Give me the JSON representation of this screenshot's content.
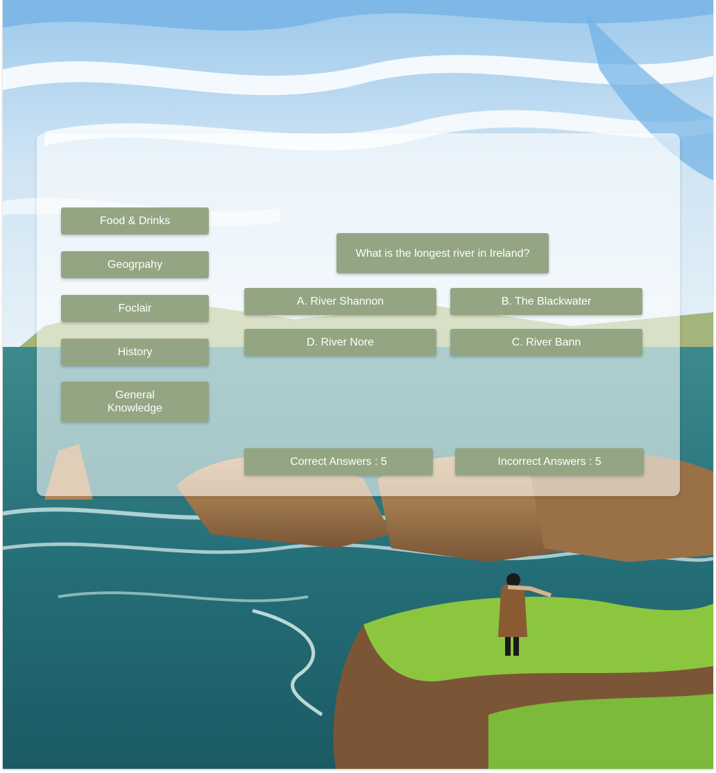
{
  "colors": {
    "button": "#94a583",
    "button_text": "#ffffff",
    "panel": "rgba(255,255,255,0.58)"
  },
  "categories": [
    {
      "label": "Food & Drinks"
    },
    {
      "label": "Geogrpahy"
    },
    {
      "label": "Foclair"
    },
    {
      "label": "History"
    },
    {
      "label": "General Knowledge"
    }
  ],
  "quiz": {
    "question": "What is the longest river in Ireland?",
    "answers": [
      {
        "label": "A. River Shannon"
      },
      {
        "label": "B. The Blackwater"
      },
      {
        "label": "D. River Nore"
      },
      {
        "label": "C. River Bann"
      }
    ]
  },
  "score": {
    "correct_label": "Correct Answers : 5",
    "incorrect_label": "Incorrect Answers : 5"
  }
}
